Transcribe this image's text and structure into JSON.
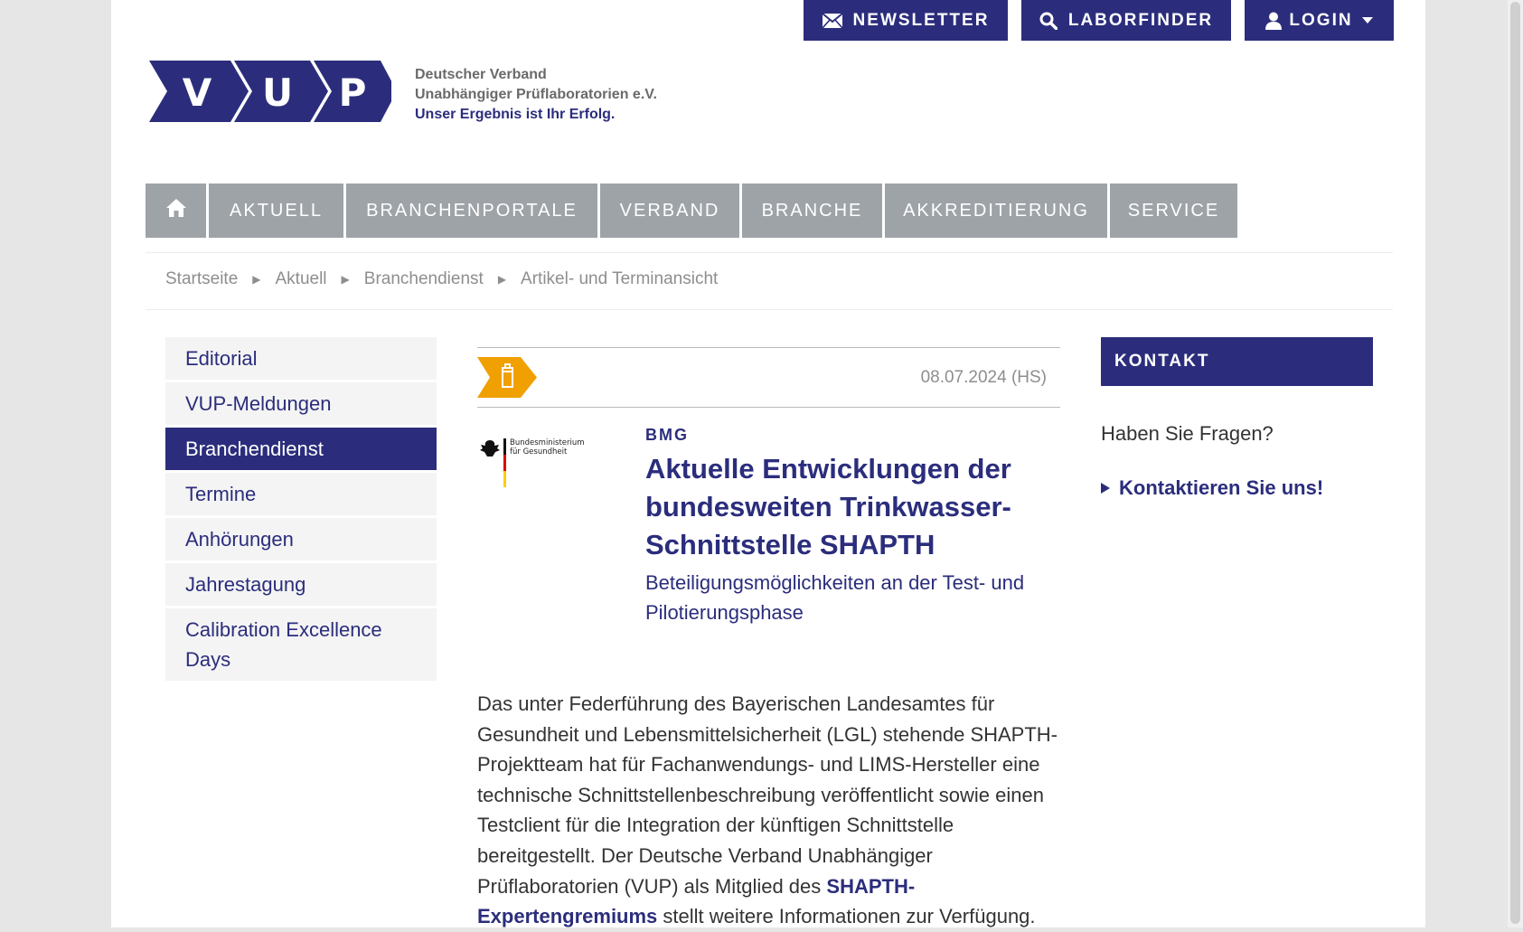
{
  "top_buttons": {
    "newsletter": "NEWSLETTER",
    "laborfinder": "LABORFINDER",
    "login": "LOGIN"
  },
  "logo": {
    "letters": [
      "V",
      "U",
      "P"
    ],
    "tagline_line1": "Deutscher Verband",
    "tagline_line2": "Unabhängiger Prüflaboratorien e.V.",
    "tagline_line3": "Unser Ergebnis ist Ihr Erfolg."
  },
  "nav": {
    "home_icon": "home-icon",
    "items": [
      "AKTUELL",
      "BRANCHENPORTALE",
      "VERBAND",
      "BRANCHE",
      "AKKREDITIERUNG",
      "SERVICE"
    ]
  },
  "breadcrumb": [
    "Startseite",
    "Aktuell",
    "Branchendienst",
    "Artikel- und Terminansicht"
  ],
  "sidebar": {
    "items": [
      "Editorial",
      "VUP-Meldungen",
      "Branchendienst",
      "Termine",
      "Anhörungen",
      "Jahrestagung",
      "Calibration Excellence Days"
    ],
    "active_index": 2
  },
  "article": {
    "date": "08.07.2024 (HS)",
    "publisher_logo_text_line1": "Bundesministerium",
    "publisher_logo_text_line2": "für Gesundheit",
    "category": "BMG",
    "title": "Aktuelle Entwicklungen der bundesweiten Trinkwasser-Schnittstelle SHAPTH",
    "subtitle": "Beteiligungsmöglichkeiten an der Test- und Pilotierungsphase",
    "body_before_link": "Das unter Federführung des Bayerischen Landesamtes für Gesundheit und Lebensmittelsicherheit (LGL) stehende SHAPTH-Projektteam hat für Fachanwendungs- und LIMS-Hersteller eine technische Schnittstellenbeschreibung veröffentlicht sowie einen Testclient für die Integration der künftigen Schnittstelle bereitgestellt. Der Deutsche Verband Unabhängiger Prüflaboratorien (VUP) als Mitglied des ",
    "body_link": "SHAPTH-Expertengremiums",
    "body_after_link": " stellt weitere Informationen zur Verfügung."
  },
  "kontakt": {
    "heading": "KONTAKT",
    "question": "Haben Sie Fragen?",
    "link": "Kontaktieren Sie uns!"
  },
  "colors": {
    "brand_blue": "#2b2d7c",
    "nav_grey": "#9ea3a8",
    "accent_orange": "#f0a000"
  }
}
